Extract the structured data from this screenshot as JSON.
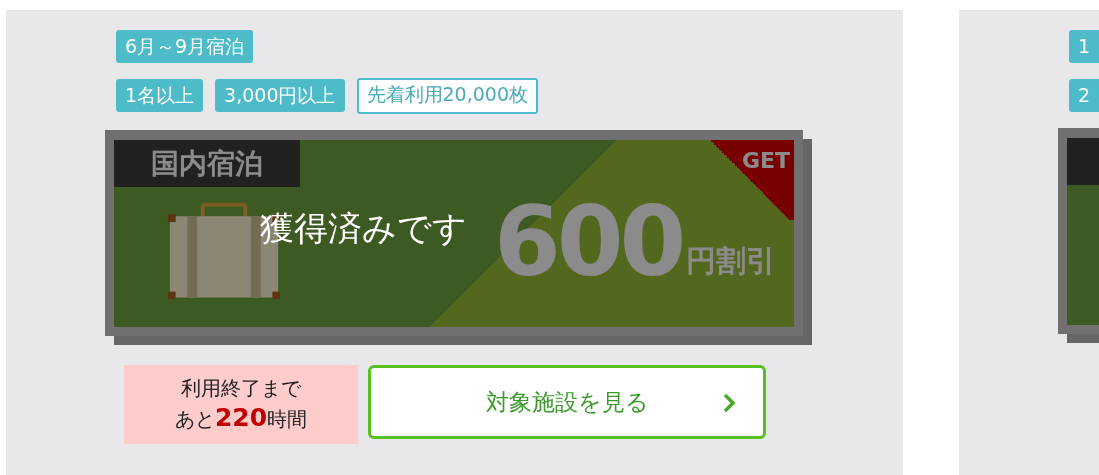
{
  "cards": [
    {
      "tags": [
        [
          "6月～9月宿泊"
        ],
        [
          "1名以上",
          "3,000円以上"
        ]
      ],
      "limit": "先着利用20,000枚",
      "coupon": {
        "category": "国内宿泊",
        "corner": "GET",
        "amount": "600",
        "unit": "円割引",
        "acquired": true,
        "overlay": "獲得済みです"
      },
      "timer": {
        "line1": "利用終了まで",
        "line2": "あと**220**時間"
      },
      "button": "対象施設を見る"
    },
    {
      "tags": [
        [
          "1"
        ],
        [
          "2"
        ]
      ],
      "coupon": {
        "acquired": true
      }
    }
  ]
}
